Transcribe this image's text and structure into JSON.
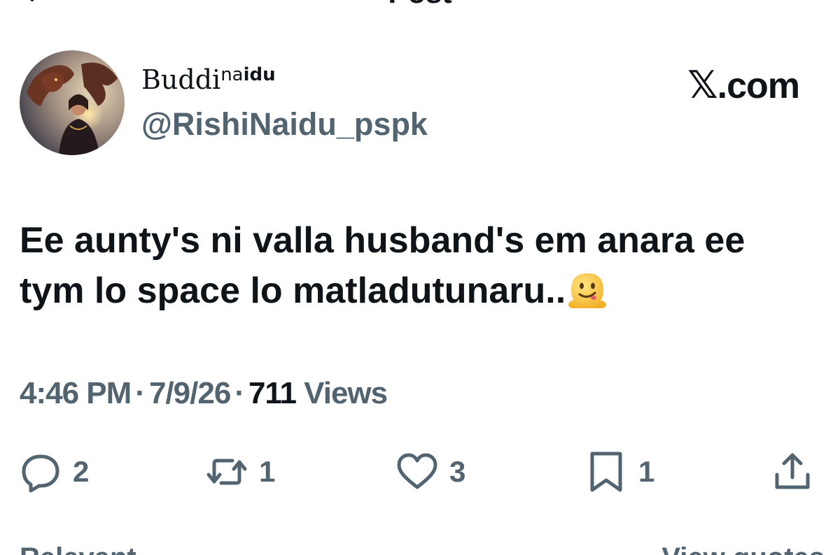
{
  "header": {
    "title": "Post"
  },
  "author": {
    "display_name": "Buddi",
    "display_name_sup_plain": "na",
    "display_name_sup_bold": "idu",
    "handle": "@RishiNaidu_pspk"
  },
  "brand": {
    "logo_icon": "x-logo-icon",
    "domain": ".com"
  },
  "tweet": {
    "text_line1": "Ee aunty's ni valla husband's em anara ee",
    "text_line2": "tym lo space lo matladutunaru..",
    "emoji": "melting-face-icon"
  },
  "meta": {
    "time": "4:46 PM",
    "date": "7/9/26",
    "views_count": "711",
    "views_label": "Views"
  },
  "actions": {
    "replies": "2",
    "reposts": "1",
    "likes": "3",
    "bookmarks": "1"
  },
  "bottom": {
    "left_label": "Relevant",
    "right_label": "View quotes"
  }
}
